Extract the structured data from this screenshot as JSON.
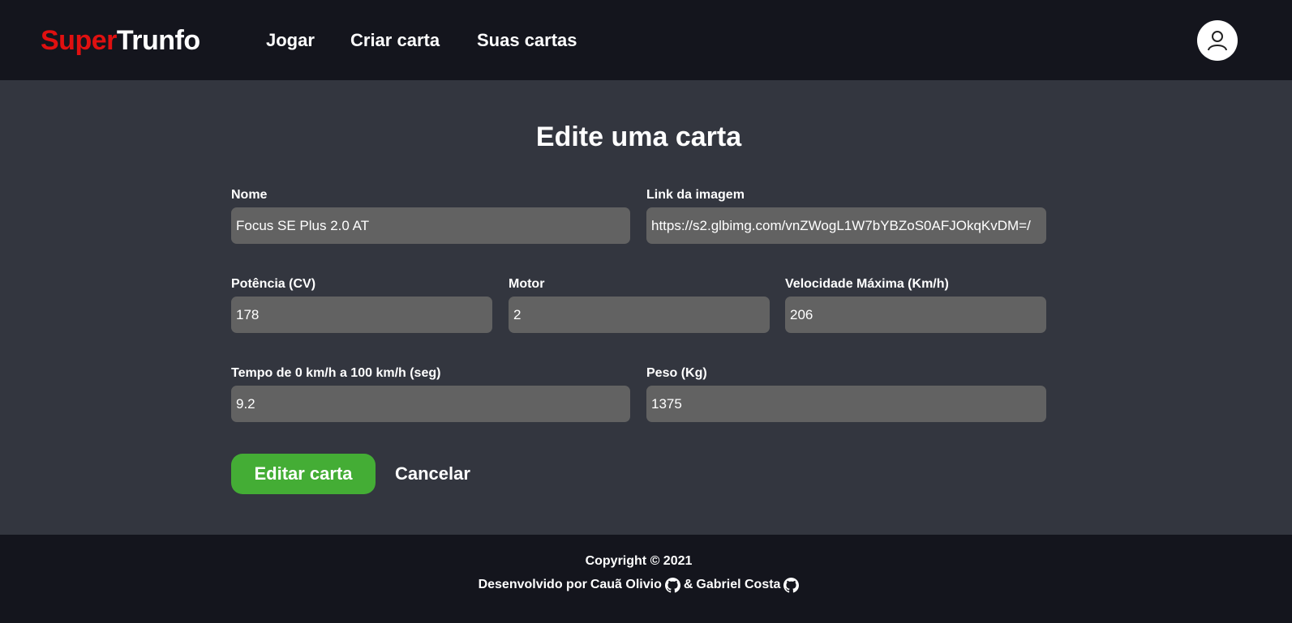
{
  "brand": {
    "part1": "Super",
    "part2": "Trunfo"
  },
  "nav": {
    "items": [
      "Jogar",
      "Criar carta",
      "Suas cartas"
    ]
  },
  "user": {
    "icon": "user-icon"
  },
  "page": {
    "title": "Edite uma carta"
  },
  "form": {
    "nome": {
      "label": "Nome",
      "value": "Focus SE Plus 2.0 AT"
    },
    "imagem": {
      "label": "Link da imagem",
      "value": "https://s2.glbimg.com/vnZWogL1W7bYBZoS0AFJOkqKvDM=/"
    },
    "potencia": {
      "label": "Potência (CV)",
      "value": "178"
    },
    "motor": {
      "label": "Motor",
      "value": "2"
    },
    "velocidade": {
      "label": "Velocidade Máxima (Km/h)",
      "value": "206"
    },
    "tempo": {
      "label": "Tempo de 0 km/h a 100 km/h (seg)",
      "value": "9.2"
    },
    "peso": {
      "label": "Peso (Kg)",
      "value": "1375"
    },
    "submit_label": "Editar carta",
    "cancel_label": "Cancelar"
  },
  "footer": {
    "copyright": "Copyright © 2021",
    "dev_prefix": "Desenvolvido por",
    "author1": "Cauã Olivio",
    "separator": "&",
    "author2": "Gabriel Costa",
    "icon": "github-icon"
  },
  "colors": {
    "header_bg": "#14151d",
    "body_bg": "#33363f",
    "input_bg": "#626262",
    "brand_red": "#e01010",
    "button_green": "#44ad35"
  }
}
